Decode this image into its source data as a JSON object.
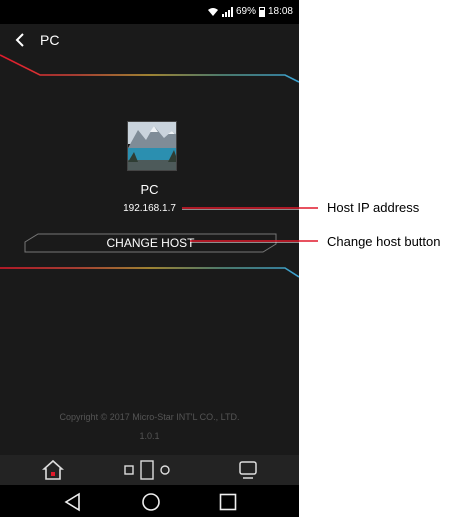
{
  "status_bar": {
    "battery_text": "69%",
    "time": "18:08",
    "battery_level": 0.69
  },
  "header": {
    "back_icon": "chevron-left-icon",
    "title": "PC"
  },
  "host": {
    "name": "PC",
    "ip": "192.168.1.7"
  },
  "actions": {
    "change_host_label": "CHANGE HOST"
  },
  "footer": {
    "copyright": "Copyright © 2017 Micro-Star INT'L CO., LTD.",
    "version": "1.0.1"
  },
  "app_nav": [
    "home-icon",
    "windows-icon",
    "display-icon"
  ],
  "system_nav": [
    "back-triangle-icon",
    "home-circle-icon",
    "recents-square-icon"
  ],
  "callouts": {
    "host_ip": "Host IP address",
    "change_host": "Change host button"
  },
  "colors": {
    "background": "#1a1a1a",
    "accent_red": "#e0192b",
    "accent_blue": "#3aa0d0",
    "callout_line": "#e0192b"
  }
}
